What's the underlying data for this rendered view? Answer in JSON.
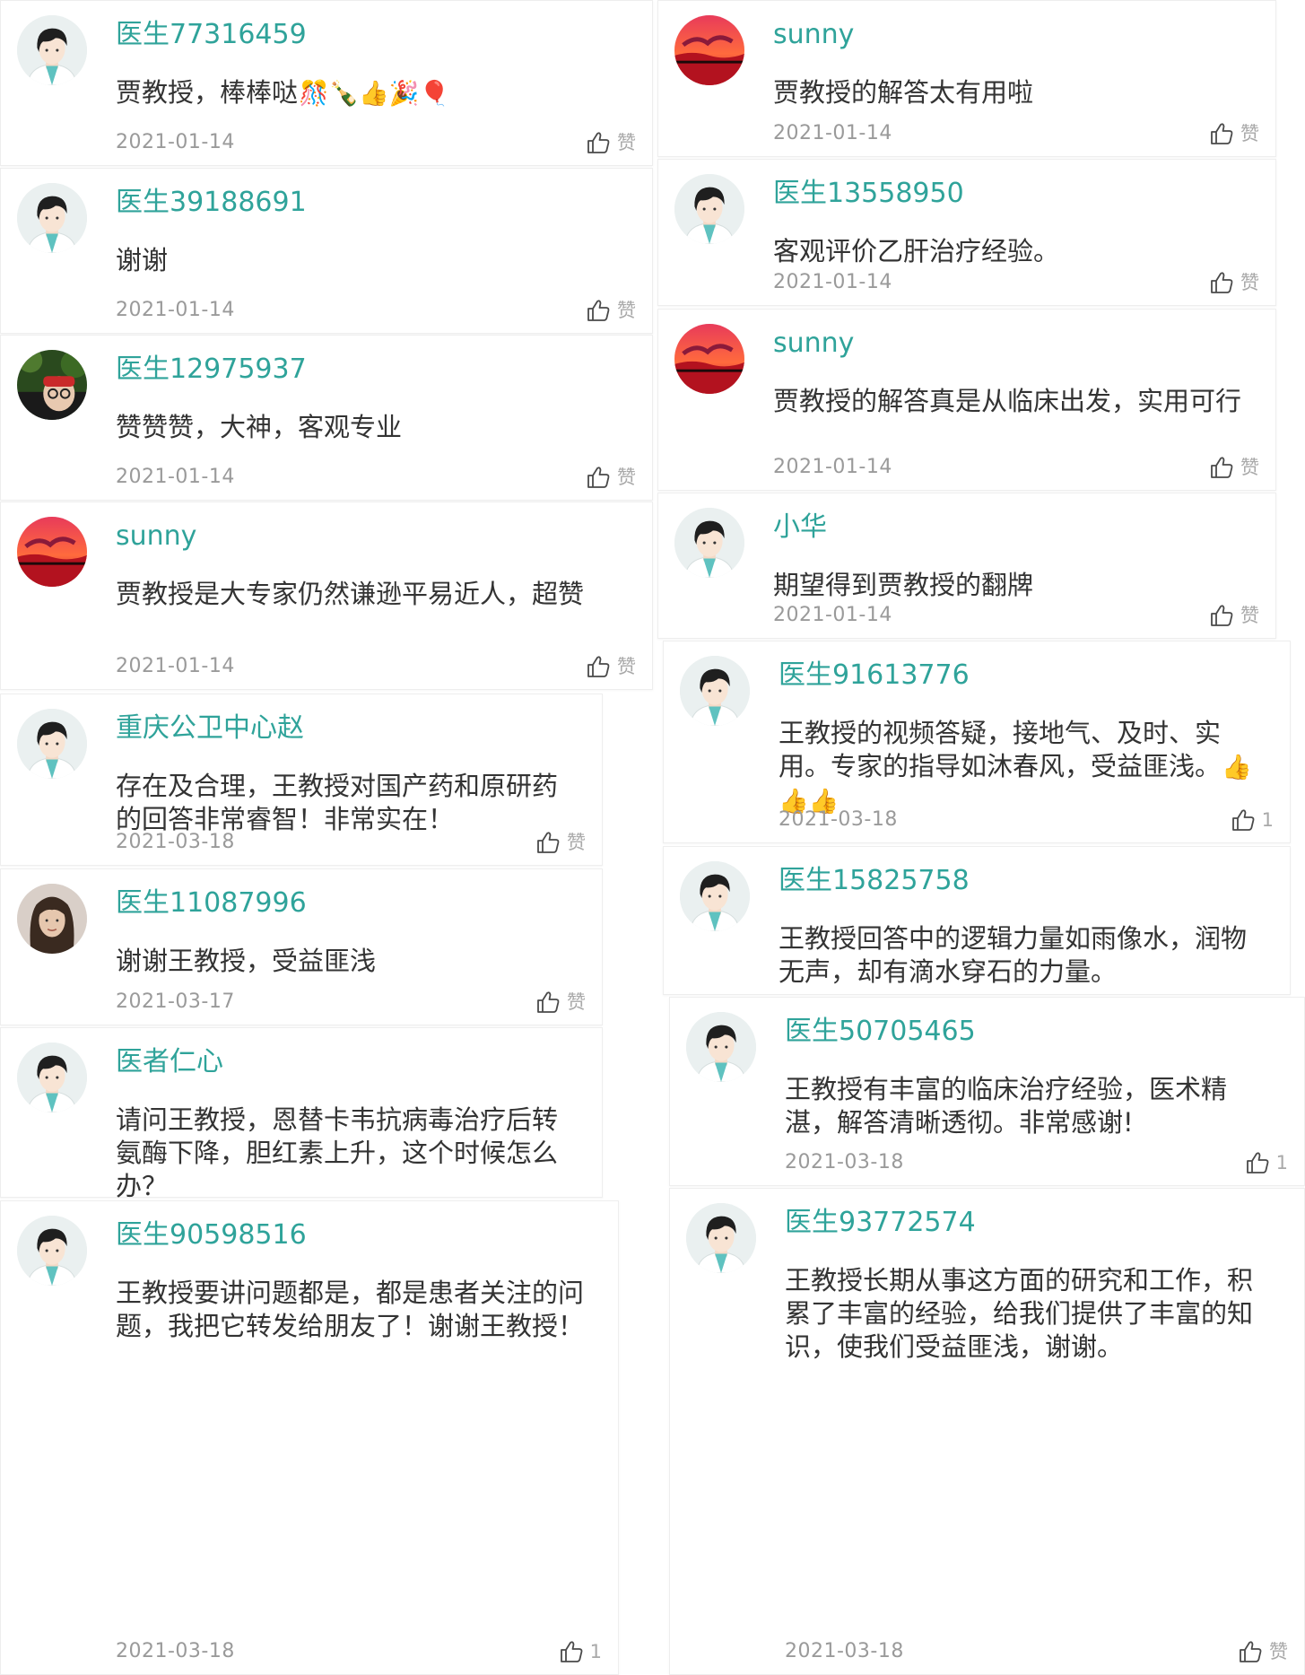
{
  "comments": [
    {
      "name": "医生77316459",
      "text": "贾教授，棒棒哒",
      "emoji": "🎊🍾👍🎉🎈",
      "date": "2021-01-14",
      "like": "赞",
      "avatar": "doctor-avatar"
    },
    {
      "name": "医生39188691",
      "text": "谢谢",
      "emoji": "",
      "date": "2021-01-14",
      "like": "赞",
      "avatar": "doctor-avatar"
    },
    {
      "name": "医生12975937",
      "text": "赞赞赞，大神，客观专业",
      "emoji": "",
      "date": "2021-01-14",
      "like": "赞",
      "avatar": "photo-avatar"
    },
    {
      "name": "sunny",
      "text": "贾教授是大专家仍然谦逊平易近人，超赞",
      "emoji": "",
      "date": "2021-01-14",
      "like": "赞",
      "avatar": "sunset-avatar"
    },
    {
      "name": "重庆公卫中心赵",
      "text": "存在及合理，王教授对国产药和原研药的回答非常睿智！非常实在！",
      "emoji": "",
      "date": "2021-03-18",
      "like": "赞",
      "avatar": "doctor-avatar"
    },
    {
      "name": "医生11087996",
      "text": "谢谢王教授，受益匪浅",
      "emoji": "",
      "date": "2021-03-17",
      "like": "赞",
      "avatar": "woman-photo-avatar"
    },
    {
      "name": "医者仁心",
      "text": "请问王教授，恩替卡韦抗病毒治疗后转氨酶下降，胆红素上升，这个时候怎么办？",
      "emoji": "",
      "date": "",
      "like": "",
      "avatar": "doctor-avatar"
    },
    {
      "name": "医生90598516",
      "text": "王教授要讲问题都是，都是患者关注的问题，我把它转发给朋友了！谢谢王教授！",
      "emoji": "",
      "date": "2021-03-18",
      "like": "1",
      "avatar": "doctor-avatar"
    },
    {
      "name": "sunny",
      "text": "贾教授的解答太有用啦",
      "emoji": "",
      "date": "2021-01-14",
      "like": "赞",
      "avatar": "sunset-avatar"
    },
    {
      "name": "医生13558950",
      "text": "客观评价乙肝治疗经验。",
      "emoji": "",
      "date": "2021-01-14",
      "like": "赞",
      "avatar": "doctor-avatar"
    },
    {
      "name": "sunny",
      "text": "贾教授的解答真是从临床出发，实用可行",
      "emoji": "",
      "date": "2021-01-14",
      "like": "赞",
      "avatar": "sunset-avatar"
    },
    {
      "name": "小华",
      "text": "期望得到贾教授的翻牌",
      "emoji": "",
      "date": "2021-01-14",
      "like": "赞",
      "avatar": "doctor-avatar"
    },
    {
      "name": "医生91613776",
      "text": "王教授的视频答疑，接地气、及时、实用。专家的指导如沐春风，受益匪浅。",
      "emoji": "👍👍👍",
      "date": "2021-03-18",
      "like": "1",
      "avatar": "doctor-avatar"
    },
    {
      "name": "医生15825758",
      "text": "王教授回答中的逻辑力量如雨像水，润物无声，却有滴水穿石的力量。",
      "emoji": "",
      "date": "",
      "like": "",
      "avatar": "doctor-avatar"
    },
    {
      "name": "医生50705465",
      "text": "王教授有丰富的临床治疗经验，医术精湛，解答清晰透彻。非常感谢!",
      "emoji": "",
      "date": "2021-03-18",
      "like": "1",
      "avatar": "doctor-avatar"
    },
    {
      "name": "医生93772574",
      "text": "王教授长期从事这方面的研究和工作，积累了丰富的经验，给我们提供了丰富的知识，使我们受益匪浅，谢谢。",
      "emoji": "",
      "date": "2021-03-18",
      "like": "赞",
      "avatar": "doctor-avatar"
    }
  ]
}
